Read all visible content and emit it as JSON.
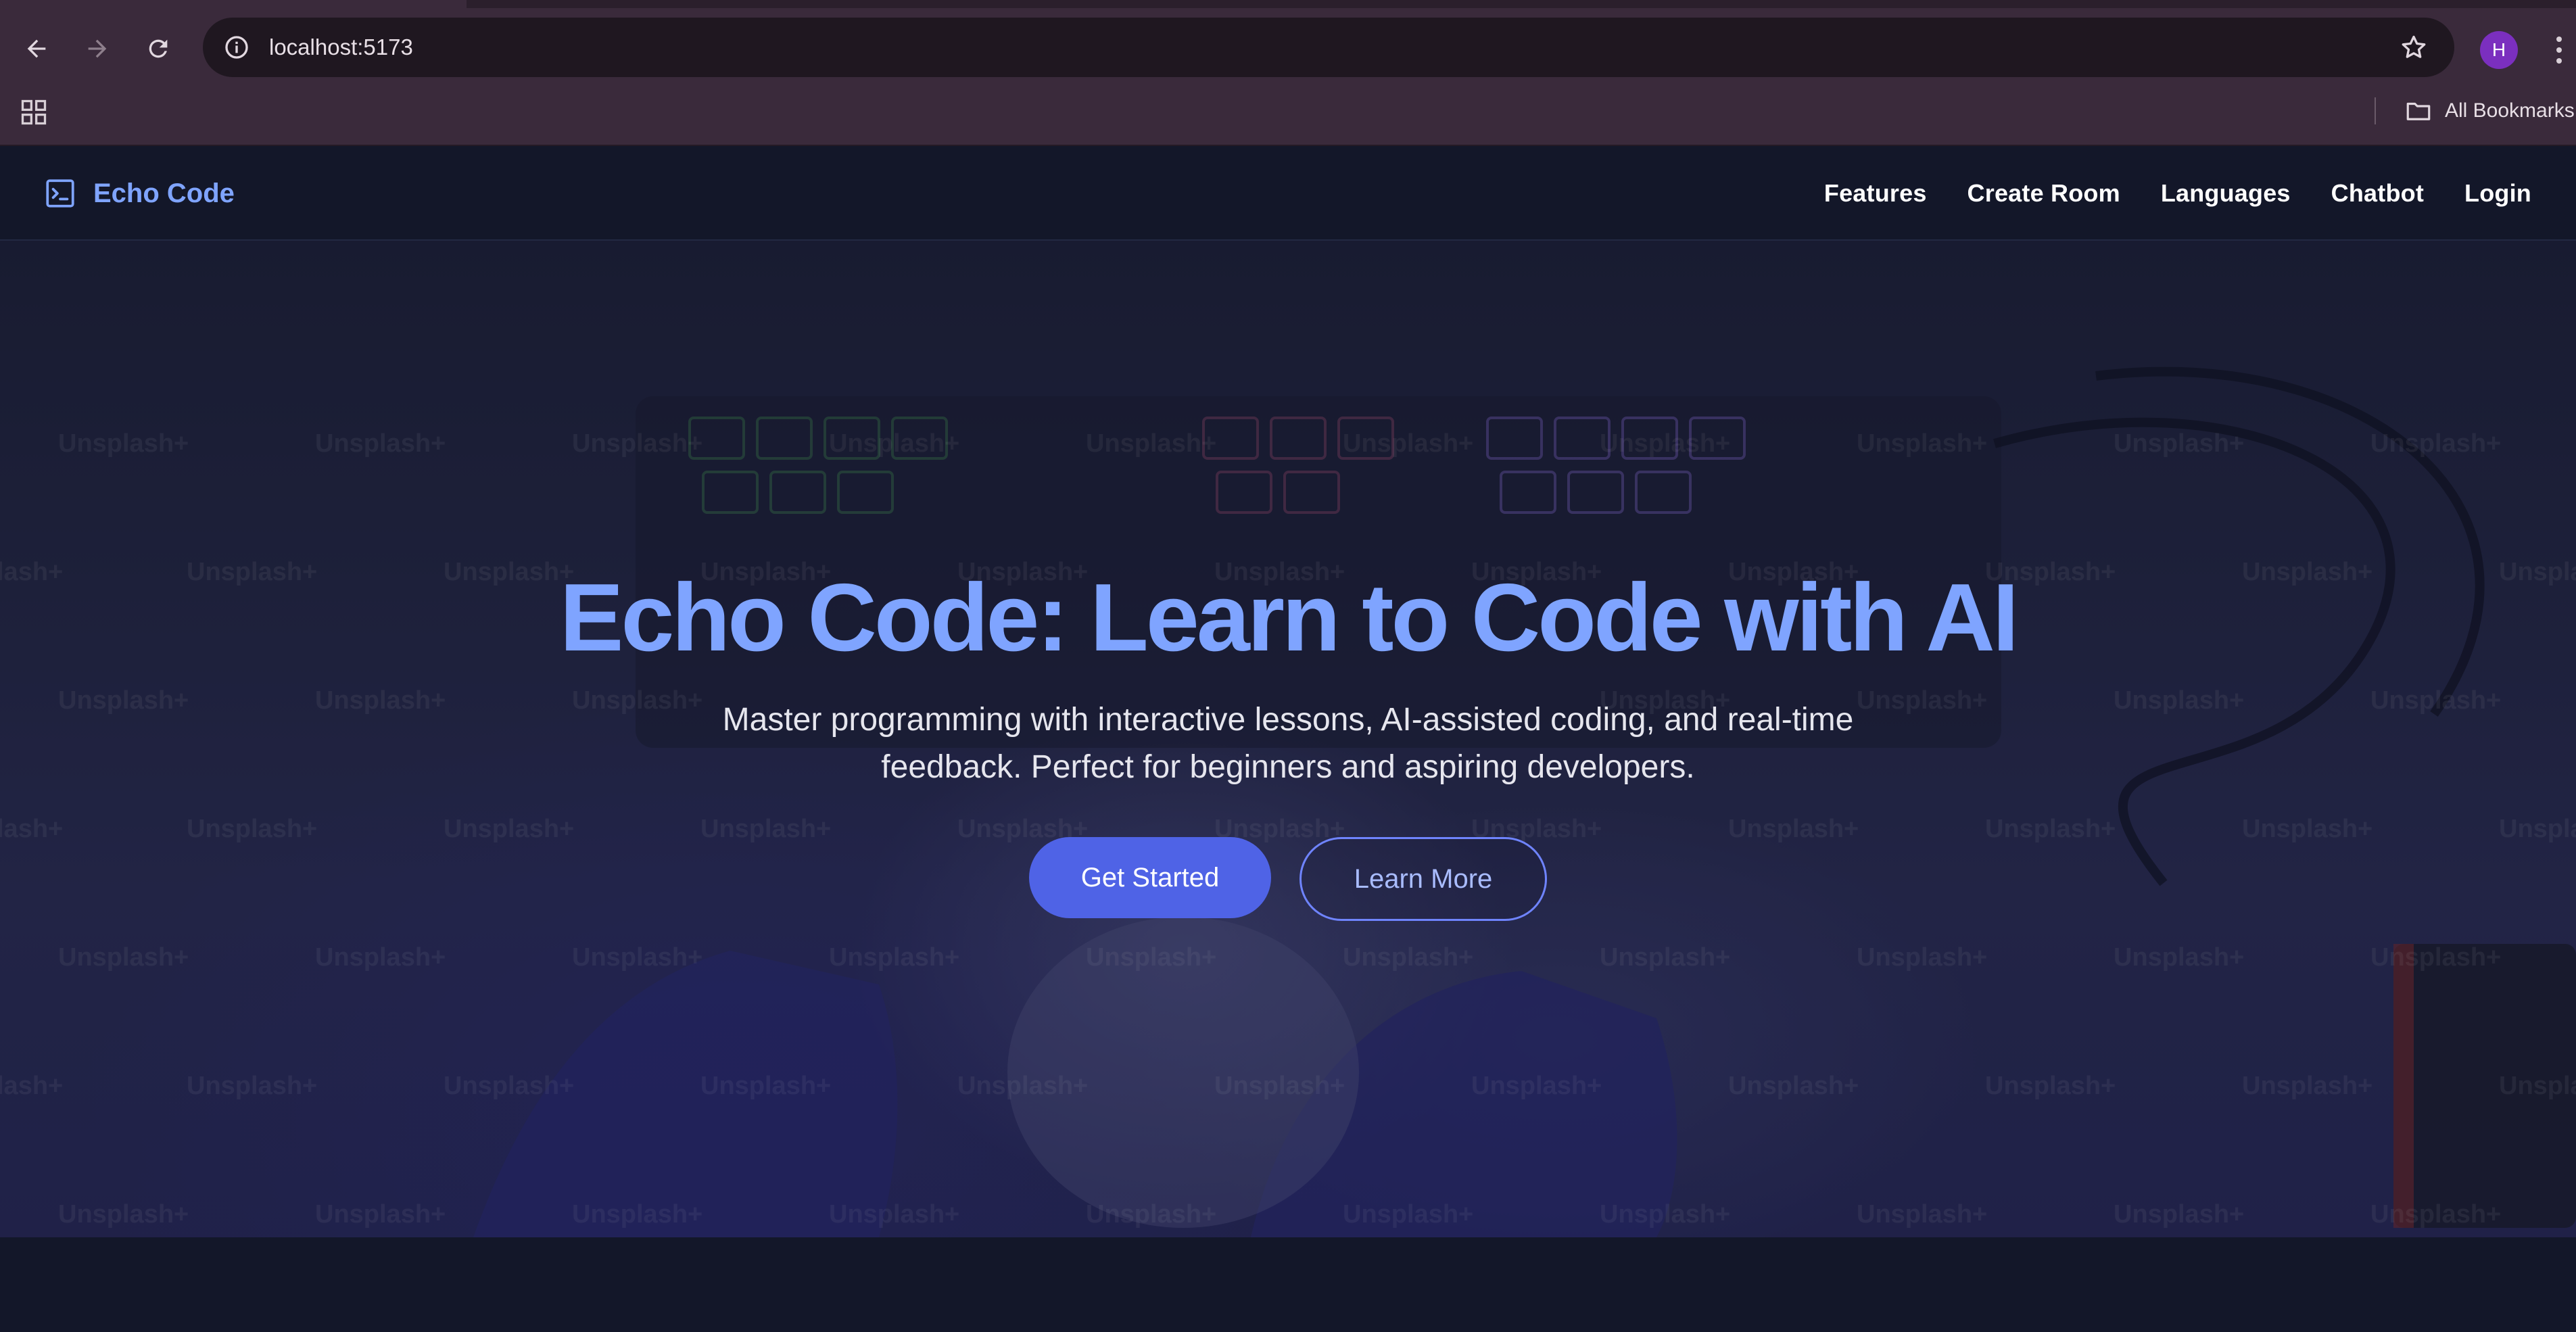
{
  "browser": {
    "url": "localhost:5173",
    "profile_initial": "H",
    "bookmarks_label": "All Bookmarks"
  },
  "site": {
    "brand": "Echo Code",
    "nav": [
      "Features",
      "Create Room",
      "Languages",
      "Chatbot",
      "Login"
    ]
  },
  "hero": {
    "title": "Echo Code: Learn to Code with AI",
    "subtitle": "Master programming with interactive lessons, AI-assisted coding, and real-time feedback. Perfect for beginners and aspiring developers.",
    "primary_cta": "Get Started",
    "secondary_cta": "Learn More",
    "background_watermark": "Unsplash+"
  },
  "colors": {
    "brand_accent": "#7fa4ff",
    "primary_button": "#4f63e6",
    "page_background": "#141729",
    "browser_chrome": "#3a2a3b",
    "profile_avatar": "#7b2fbf"
  }
}
